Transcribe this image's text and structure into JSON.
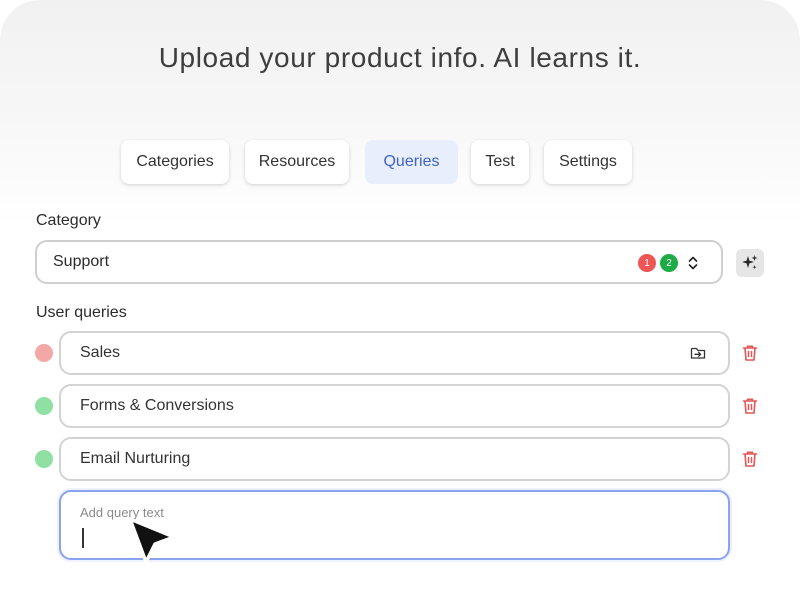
{
  "headline": "Upload your product info. AI learns it.",
  "tabs": [
    {
      "label": "Categories"
    },
    {
      "label": "Resources"
    },
    {
      "label": "Queries",
      "active": true
    },
    {
      "label": "Test"
    },
    {
      "label": "Settings"
    }
  ],
  "category": {
    "label": "Category",
    "value": "Support",
    "badges": [
      {
        "count": "1",
        "color": "#ef5555"
      },
      {
        "count": "2",
        "color": "#1cab45"
      }
    ]
  },
  "queries": {
    "label": "User queries",
    "items": [
      {
        "text": "Sales",
        "status_color": "#f3a7a7"
      },
      {
        "text": "Forms & Conversions",
        "status_color": "#8fe0a2"
      },
      {
        "text": "Email Nurturing",
        "status_color": "#8fe0a2"
      }
    ],
    "new_placeholder": "Add query text"
  },
  "colors": {
    "accent": "#3f63c9",
    "active_tab_bg": "#e8eefc",
    "delete": "#e45757",
    "focus_border": "#8aa3f0"
  },
  "icons": {
    "select": "chevron-up-down-icon",
    "magic": "sparkles-icon",
    "move": "folder-move-icon",
    "delete": "trash-icon"
  }
}
